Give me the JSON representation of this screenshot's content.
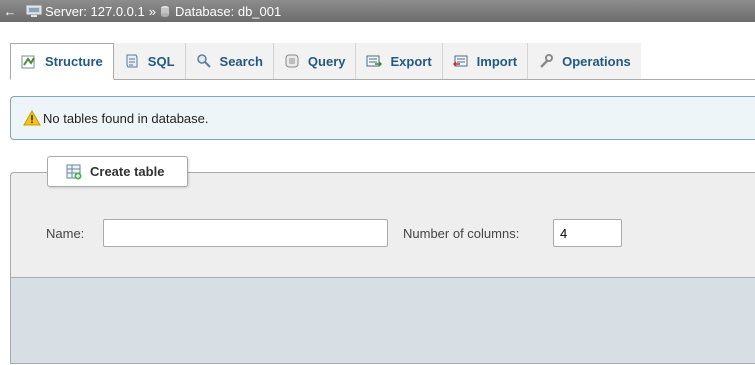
{
  "breadcrumb": {
    "back_glyph": "←",
    "server_label": "Server: 127.0.0.1",
    "separator": "»",
    "database_label": "Database: db_001"
  },
  "tabs": [
    {
      "label": "Structure",
      "icon": "structure-icon",
      "active": true
    },
    {
      "label": "SQL",
      "icon": "sql-icon"
    },
    {
      "label": "Search",
      "icon": "search-icon"
    },
    {
      "label": "Query",
      "icon": "query-icon"
    },
    {
      "label": "Export",
      "icon": "export-icon"
    },
    {
      "label": "Import",
      "icon": "import-icon"
    },
    {
      "label": "Operations",
      "icon": "wrench-icon"
    }
  ],
  "notice": {
    "text": "No tables found in database.",
    "icon": "warning-icon"
  },
  "create_table": {
    "legend": "Create table",
    "name_label": "Name:",
    "name_value": "",
    "columns_label": "Number of columns:",
    "columns_value": "4"
  },
  "colors": {
    "topbar": "#7a7a7a",
    "tab_text": "#235a81",
    "notice_bg": "#eef5f8",
    "fieldset_bg": "#eeeeee",
    "footer_bg": "#d7dee4"
  }
}
